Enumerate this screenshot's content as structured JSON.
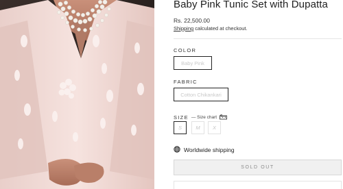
{
  "product": {
    "title": "Baby Pink Tunic Set with Dupatta",
    "price": "Rs. 22,500.00",
    "shipping_link": "Shipping",
    "shipping_rest": " calculated at checkout."
  },
  "options": {
    "color": {
      "label": "COLOR",
      "selected": "Baby Pink"
    },
    "fabric": {
      "label": "FABRIC",
      "selected": "Cotton Chikankari"
    },
    "size": {
      "label": "SIZE",
      "chart_label": "— Size chart",
      "values": [
        "S",
        "M",
        "X"
      ],
      "selected": "S"
    }
  },
  "shipping": {
    "label": "Worldwide shipping"
  },
  "cta": {
    "label": "SOLD OUT"
  },
  "icons": {
    "ruler": "ruler-icon",
    "globe": "globe-icon"
  },
  "colors": {
    "product_pink": "#f3dcd9",
    "border": "#222222",
    "disabled": "#f0f0f0"
  }
}
